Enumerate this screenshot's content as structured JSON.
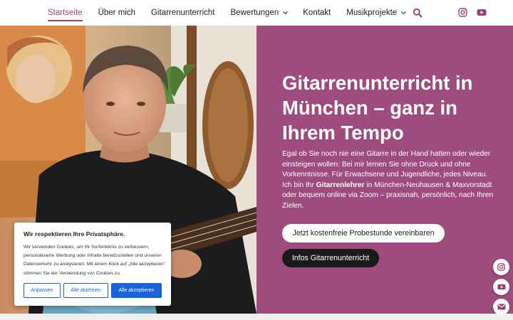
{
  "nav": {
    "items": [
      {
        "label": "Startseite",
        "active": true,
        "has_dropdown": false
      },
      {
        "label": "Über mich",
        "active": false,
        "has_dropdown": false
      },
      {
        "label": "Gitarrenunterricht",
        "active": false,
        "has_dropdown": false
      },
      {
        "label": "Bewertungen",
        "active": false,
        "has_dropdown": true
      },
      {
        "label": "Kontakt",
        "active": false,
        "has_dropdown": false
      },
      {
        "label": "Musikprojekte",
        "active": false,
        "has_dropdown": true
      }
    ],
    "icons": [
      "search-icon",
      "instagram-icon",
      "youtube-icon"
    ]
  },
  "hero": {
    "title_line1": "Gitarrenunterricht in",
    "title_line2": "München – ganz in",
    "title_line3": "Ihrem Tempo",
    "text_part1": "Egal ob Sie noch nie eine Gitarre in der Hand hatten oder wieder einsteigen wollen: Bei mir lernen Sie ohne Druck und ohne Vorkenntnisse. Für Erwachsene und Jugendliche, jedes Niveau. Ich bin Ihr ",
    "text_bold": "Gitarrenlehrer",
    "text_part2": " in München-Neuhausen & Maxvorstadt oder bequem online via Zoom – praxisnah, persönlich, nach Ihren Zielen.",
    "button_primary": "Jetzt kostenfreie Probestunde vereinbaren",
    "button_secondary": "Infos Gitarrenunterricht"
  },
  "floating_social": [
    "instagram-icon",
    "youtube-icon",
    "email-icon"
  ],
  "cookie": {
    "title": "Wir respektieren Ihre Privatsphäre.",
    "text": "Wir verwenden Cookies, um Ihr Surferlebnis zu verbessern, personalisierte Werbung oder Inhalte bereitzustellen und unseren Datenverkehr zu analysieren. Mit einem Klick auf „Alle akzeptieren“ stimmen Sie der Verwendung von Cookies zu.",
    "btn_customize": "Anpassen",
    "btn_reject": "Alle ablehnen",
    "btn_accept": "Alle akzeptieren"
  },
  "colors": {
    "accent": "#9e3e78",
    "hero_panel": "#9e4c7d",
    "cookie_blue": "#1863dc"
  }
}
